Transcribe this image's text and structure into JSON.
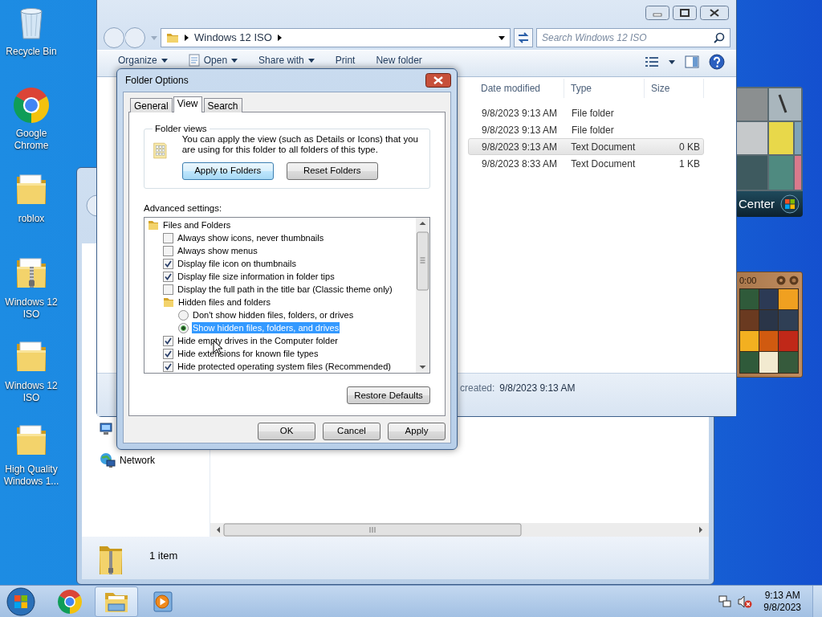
{
  "desktop_icons": [
    {
      "kind": "recycle-bin",
      "label": "Recycle Bin"
    },
    {
      "kind": "chrome",
      "label": "Google Chrome"
    },
    {
      "kind": "folder",
      "label": "roblox"
    },
    {
      "kind": "zip",
      "label": "Windows 12 ISO"
    },
    {
      "kind": "folder",
      "label": "Windows 12 ISO"
    },
    {
      "kind": "folder",
      "label": "High Quality Windows 1..."
    }
  ],
  "back_window": {
    "nav": [
      {
        "kind": "computer"
      },
      {
        "kind": "network",
        "label": "Network"
      }
    ],
    "status": "1 item"
  },
  "explorer": {
    "breadcrumb": [
      "Windows 12 ISO"
    ],
    "search_placeholder": "Search Windows 12 ISO",
    "toolbar": [
      {
        "label": "Organize",
        "dropdown": true,
        "has_icon": false
      },
      {
        "label": "Open",
        "dropdown": true,
        "has_icon": true
      },
      {
        "label": "Share with",
        "dropdown": true,
        "has_icon": false
      },
      {
        "label": "Print",
        "dropdown": false,
        "has_icon": false
      },
      {
        "label": "New folder",
        "dropdown": false,
        "has_icon": false
      }
    ],
    "columns": [
      "Date modified",
      "Type",
      "Size"
    ],
    "rows": [
      {
        "date": "9/8/2023 9:13 AM",
        "type": "File folder",
        "selected": false
      },
      {
        "date": "9/8/2023 9:13 AM",
        "type": "File folder",
        "selected": false
      },
      {
        "date": "9/8/2023 9:13 AM",
        "type": "Text Document",
        "size": "0 KB",
        "selected": true
      },
      {
        "date": "9/8/2023 8:33 AM",
        "type": "Text Document",
        "size": "1 KB",
        "selected": false
      }
    ],
    "details": {
      "label": "created:",
      "value": "9/8/2023 9:13 AM"
    }
  },
  "gadgets": {
    "media_center_label": "Center",
    "puzzle_time": "0:00"
  },
  "dialog": {
    "title": "Folder Options",
    "tabs": [
      {
        "label": "General",
        "selected": false
      },
      {
        "label": "View",
        "selected": true
      },
      {
        "label": "Search",
        "selected": false
      }
    ],
    "group_title": "Folder views",
    "description": "You can apply the view (such as Details or Icons) that you are using for this folder to all folders of this type.",
    "group_buttons": [
      {
        "label": "Apply to Folders",
        "focused": true
      },
      {
        "label": "Reset Folders",
        "focused": false
      }
    ],
    "advanced_label": "Advanced settings:",
    "settings": [
      {
        "kind": "folder",
        "label": "Files and Folders",
        "selected": false,
        "children": [
          {
            "kind": "checkbox",
            "label": "Always show icons, never thumbnails",
            "checked": false,
            "selected": false
          },
          {
            "kind": "checkbox",
            "label": "Always show menus",
            "checked": false,
            "selected": false
          },
          {
            "kind": "checkbox",
            "label": "Display file icon on thumbnails",
            "checked": true,
            "selected": false
          },
          {
            "kind": "checkbox",
            "label": "Display file size information in folder tips",
            "checked": true,
            "selected": false
          },
          {
            "kind": "checkbox",
            "label": "Display the full path in the title bar (Classic theme only)",
            "checked": false,
            "selected": false
          },
          {
            "kind": "folder",
            "label": "Hidden files and folders",
            "selected": false,
            "children": [
              {
                "kind": "radio",
                "label": "Don't show hidden files, folders, or drives",
                "checked": false,
                "selected": false
              },
              {
                "kind": "radio",
                "label": "Show hidden files, folders, and drives",
                "checked": true,
                "selected": true
              }
            ]
          },
          {
            "kind": "checkbox",
            "label": "Hide empty drives in the Computer folder",
            "checked": true,
            "selected": false
          },
          {
            "kind": "checkbox",
            "label": "Hide extensions for known file types",
            "checked": true,
            "selected": false
          },
          {
            "kind": "checkbox",
            "label": "Hide protected operating system files (Recommended)",
            "checked": true,
            "selected": false
          }
        ]
      }
    ],
    "restore_button": "Restore Defaults",
    "buttons": [
      "OK",
      "Cancel",
      "Apply"
    ]
  },
  "taskbar": {
    "items": [
      {
        "kind": "chrome",
        "active": false
      },
      {
        "kind": "explorer",
        "active": true
      },
      {
        "kind": "media",
        "active": false
      }
    ],
    "time": "9:13 AM",
    "date": "9/8/2023"
  }
}
